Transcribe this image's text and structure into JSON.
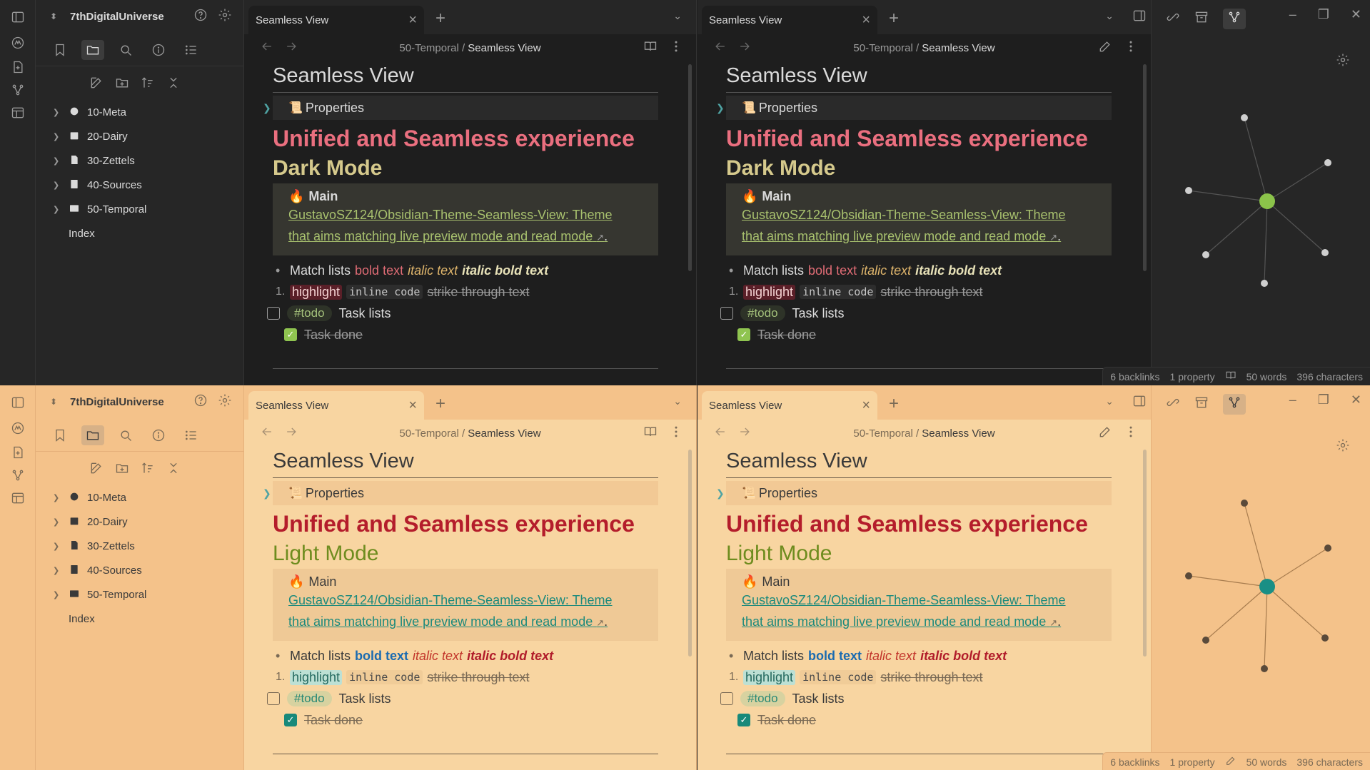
{
  "vault": {
    "name": "7thDigitalUniverse"
  },
  "tree": [
    {
      "label": "10-Meta",
      "icon": "gear-icon"
    },
    {
      "label": "20-Dairy",
      "icon": "calendar-icon"
    },
    {
      "label": "30-Zettels",
      "icon": "note-icon"
    },
    {
      "label": "40-Sources",
      "icon": "book-icon"
    },
    {
      "label": "50-Temporal",
      "icon": "image-icon"
    }
  ],
  "tree_file": "Index",
  "tab": {
    "title": "Seamless View",
    "close": "×",
    "new": "+"
  },
  "breadcrumb": {
    "parent": "50-Temporal",
    "sep": "/",
    "current": "Seamless View"
  },
  "note": {
    "title": "Seamless View",
    "properties": "Properties",
    "h1": "Unified and Seamless experience",
    "callout_title": "Main",
    "link_line1": "GustavoSZ124/Obsidian-Theme-Seamless-View: Theme",
    "link_line2": "that aims matching live preview mode and read mode",
    "list_prefix": "Match lists",
    "bold": "bold text",
    "italic": "italic text",
    "italic_bold": "italic bold text",
    "highlight": "highlight",
    "code": "inline code",
    "strike": "strike through text",
    "tag": "#todo",
    "task": "Task lists",
    "task_done": "Task done",
    "num": "1."
  },
  "themes": {
    "dark": {
      "h2": "Dark Mode"
    },
    "light": {
      "h2": "Light Mode"
    }
  },
  "status": {
    "backlinks": "6 backlinks",
    "property": "1 property",
    "words": "50 words",
    "characters": "396 characters"
  },
  "window_controls": {
    "minimize": "–",
    "maximize": "❐",
    "close": "✕"
  },
  "colors": {
    "dark_graph_center": "#8bc34a",
    "light_graph_center": "#1a8f85",
    "light_background": "#f8d5a1",
    "dark_background": "#1e1e1e"
  }
}
